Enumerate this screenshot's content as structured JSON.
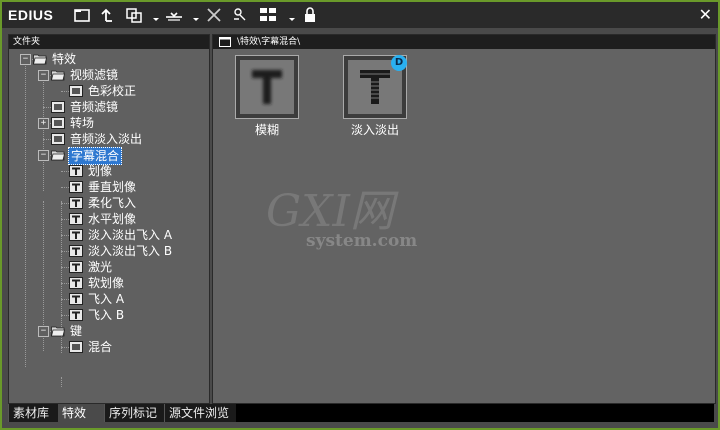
{
  "app": {
    "title": "EDIUS"
  },
  "toolbar": {
    "icons": [
      "new-folder-icon",
      "up-folder-icon",
      "copy-icon",
      "import-icon",
      "delete-icon",
      "properties-icon",
      "view-mode-icon",
      "lock-icon"
    ]
  },
  "left_pane": {
    "header": "文件夹",
    "tree": [
      {
        "label": "特效",
        "level": 0,
        "expander": "-"
      },
      {
        "label": "视频滤镜",
        "level": 1,
        "expander": "-"
      },
      {
        "label": "色彩校正",
        "level": 2,
        "expander": ""
      },
      {
        "label": "音频滤镜",
        "level": 1,
        "expander": ""
      },
      {
        "label": "转场",
        "level": 1,
        "expander": "+"
      },
      {
        "label": "音频淡入淡出",
        "level": 1,
        "expander": ""
      },
      {
        "label": "字幕混合",
        "level": 1,
        "expander": "-",
        "selected": true
      },
      {
        "label": "划像",
        "level": 2
      },
      {
        "label": "垂直划像",
        "level": 2
      },
      {
        "label": "柔化飞入",
        "level": 2
      },
      {
        "label": "水平划像",
        "level": 2
      },
      {
        "label": "淡入淡出飞入 A",
        "level": 2
      },
      {
        "label": "淡入淡出飞入 B",
        "level": 2
      },
      {
        "label": "激光",
        "level": 2
      },
      {
        "label": "软划像",
        "level": 2
      },
      {
        "label": "飞入 A",
        "level": 2
      },
      {
        "label": "飞入 B",
        "level": 2
      },
      {
        "label": "键",
        "level": 1,
        "expander": "-"
      },
      {
        "label": "混合",
        "level": 2
      }
    ]
  },
  "right_pane": {
    "path": "\\特效\\字幕混合\\",
    "items": [
      {
        "label": "模糊",
        "badge": ""
      },
      {
        "label": "淡入淡出",
        "badge": "D"
      }
    ]
  },
  "watermark": {
    "brand": "GXI网",
    "domain": "system.com"
  },
  "tabs": [
    {
      "label": "素材库",
      "active": false
    },
    {
      "label": "特效",
      "active": true
    },
    {
      "label": "序列标记",
      "active": false
    },
    {
      "label": "源文件浏览",
      "active": false
    }
  ],
  "colors": {
    "accent": "#2e78d0",
    "border": "#6a9a2a",
    "badge": "#2ab0f0"
  }
}
